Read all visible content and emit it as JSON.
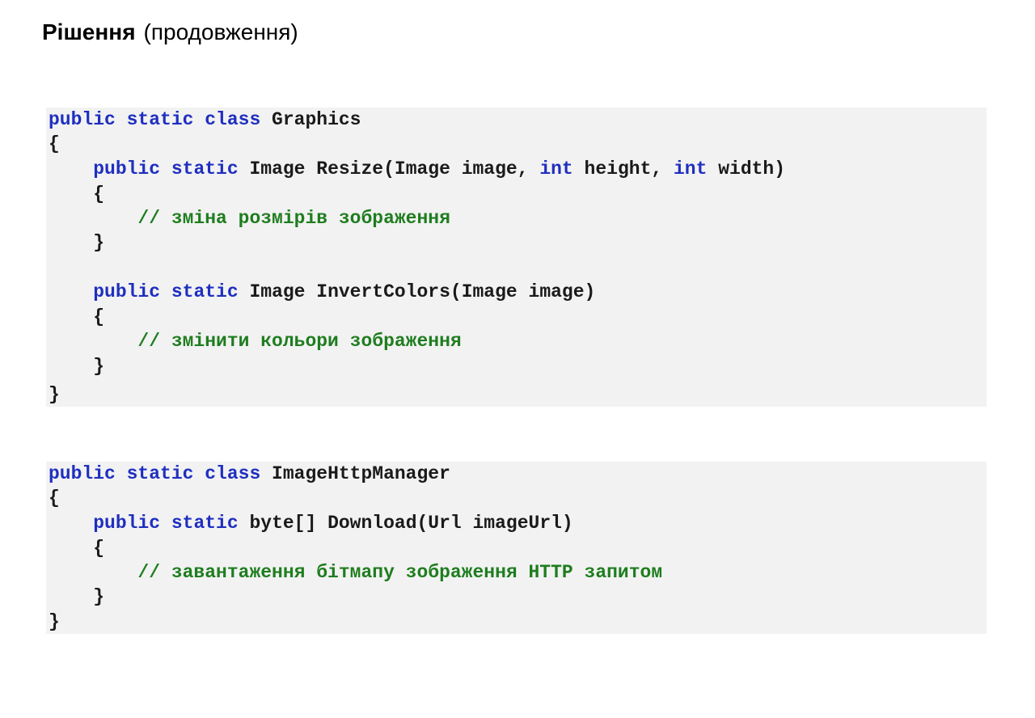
{
  "slide": {
    "title_bold": "Рішення",
    "title_sub": "(продовження)"
  },
  "code_blocks": [
    {
      "lines": [
        [
          {
            "t": "kw",
            "s": "public static class"
          },
          {
            "t": "pl",
            "s": " Graphics"
          }
        ],
        [
          {
            "t": "pl",
            "s": "{"
          }
        ],
        [
          {
            "t": "pl",
            "s": "    "
          },
          {
            "t": "kw",
            "s": "public static"
          },
          {
            "t": "pl",
            "s": " Image Resize(Image image, "
          },
          {
            "t": "kw",
            "s": "int"
          },
          {
            "t": "pl",
            "s": " height, "
          },
          {
            "t": "kw",
            "s": "int"
          },
          {
            "t": "pl",
            "s": " width)"
          }
        ],
        [
          {
            "t": "pl",
            "s": "    {"
          }
        ],
        [
          {
            "t": "pl",
            "s": "        "
          },
          {
            "t": "cm",
            "s": "// зміна розмірів зображення"
          }
        ],
        [
          {
            "t": "pl",
            "s": "    }"
          }
        ],
        [],
        [
          {
            "t": "pl",
            "s": "    "
          },
          {
            "t": "kw",
            "s": "public static"
          },
          {
            "t": "pl",
            "s": " Image InvertColors(Image image)"
          }
        ],
        [
          {
            "t": "pl",
            "s": "    {"
          }
        ],
        [
          {
            "t": "pl",
            "s": "        "
          },
          {
            "t": "cm",
            "s": "// змінити кольори зображення"
          }
        ],
        [
          {
            "t": "pl",
            "s": "    }"
          }
        ],
        [
          {
            "t": "pl",
            "s": "}"
          }
        ]
      ]
    },
    {
      "lines": [
        [
          {
            "t": "kw",
            "s": "public static class"
          },
          {
            "t": "pl",
            "s": " ImageHttpManager"
          }
        ],
        [
          {
            "t": "pl",
            "s": "{"
          }
        ],
        [
          {
            "t": "pl",
            "s": "    "
          },
          {
            "t": "kw",
            "s": "public static"
          },
          {
            "t": "pl",
            "s": " byte[] Download(Url imageUrl)"
          }
        ],
        [
          {
            "t": "pl",
            "s": "    {"
          }
        ],
        [
          {
            "t": "pl",
            "s": "        "
          },
          {
            "t": "cm",
            "s": "// завантаження бітмапу зображення HTTP запитом"
          }
        ],
        [
          {
            "t": "pl",
            "s": "    }"
          }
        ],
        [
          {
            "t": "pl",
            "s": "}"
          }
        ]
      ]
    }
  ],
  "colors": {
    "keyword": "#1f2fbf",
    "comment": "#1e7d1e",
    "code_background": "#f2f2f2"
  }
}
